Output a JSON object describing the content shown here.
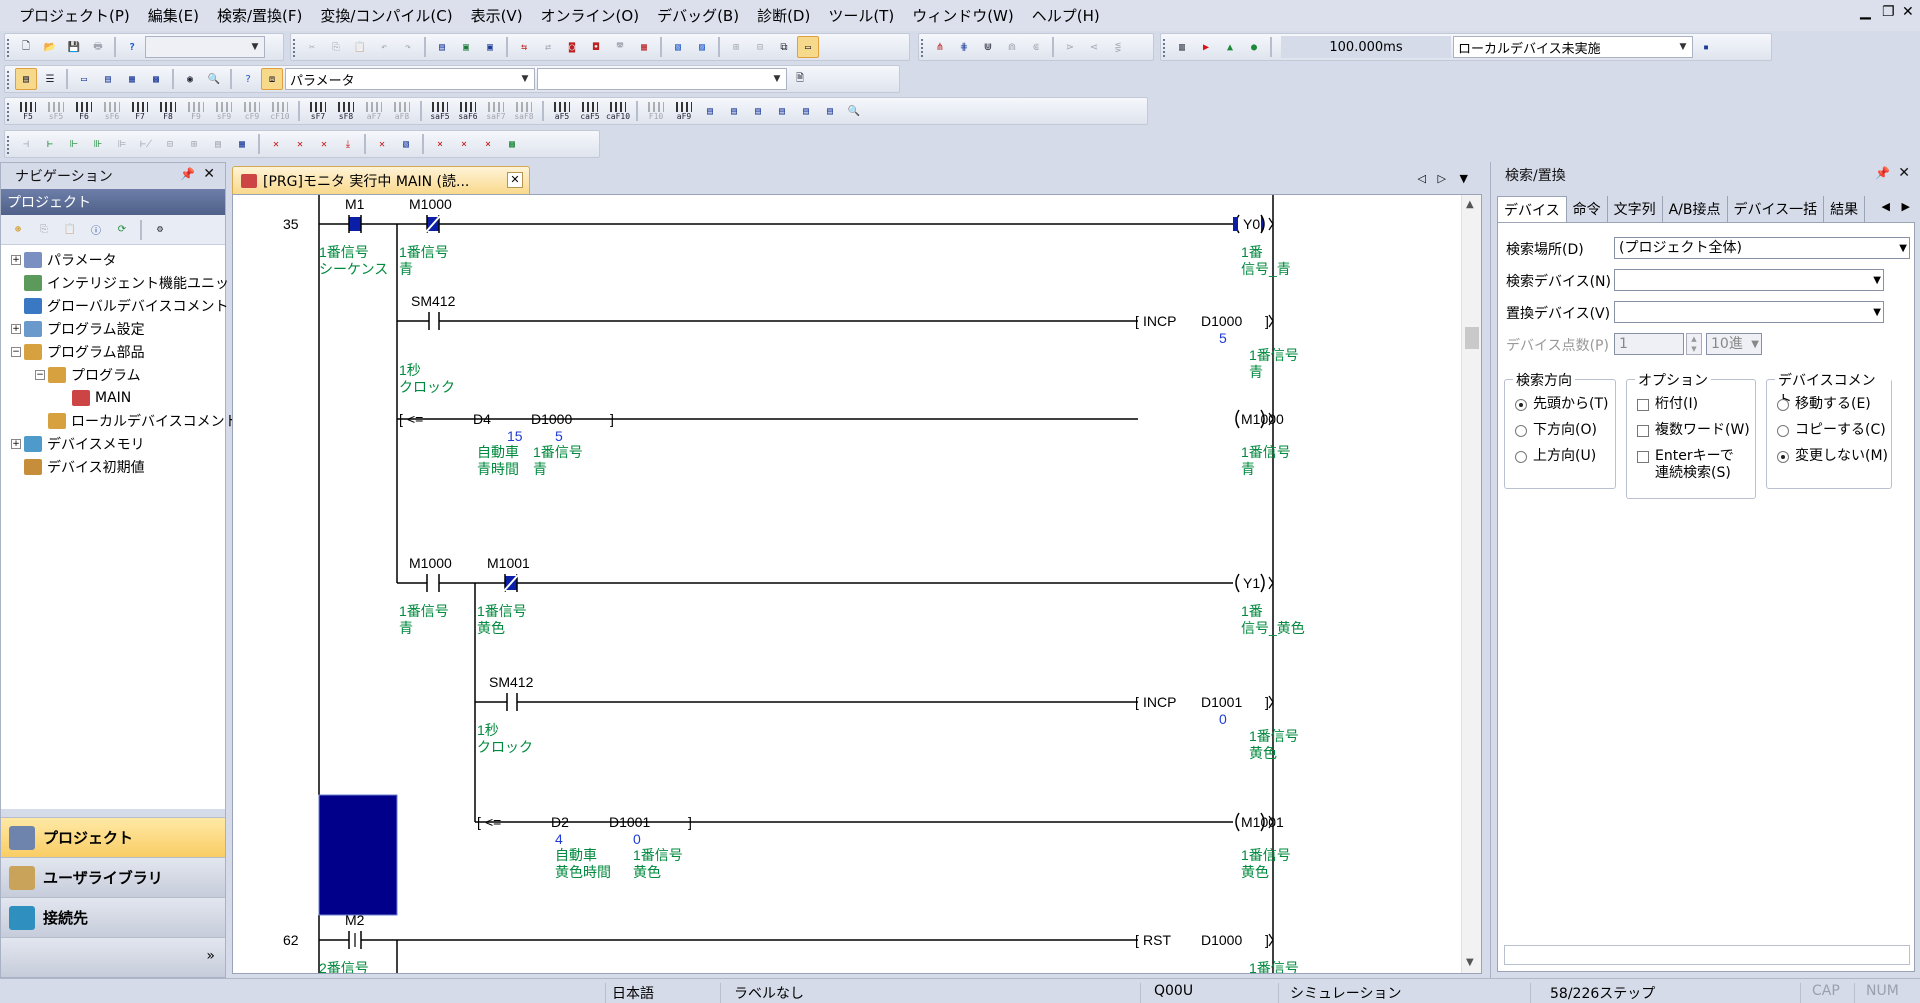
{
  "menu": [
    "プロジェクト(P)",
    "編集(E)",
    "検索/置換(F)",
    "変換/コンパイル(C)",
    "表示(V)",
    "オンライン(O)",
    "デバッグ(B)",
    "診断(D)",
    "ツール(T)",
    "ウィンドウ(W)",
    "ヘルプ(H)"
  ],
  "toolbar": {
    "scan_time": "100.000ms",
    "local_device": "ローカルデバイス未実施",
    "param_combo": "パラメータ"
  },
  "fkeys": [
    "F5",
    "sF5",
    "F6",
    "sF6",
    "F7",
    "F8",
    "F9",
    "sF9",
    "cF9",
    "cF10",
    "sF7",
    "sF8",
    "aF7",
    "aF8",
    "saF5",
    "saF6",
    "saF7",
    "saF8",
    "aF5",
    "caF5",
    "caF10",
    "F10",
    "aF9"
  ],
  "nav": {
    "title": "ナビゲーション",
    "project_header": "プロジェクト",
    "tree": [
      {
        "label": "パラメータ",
        "level": 0,
        "exp": "+"
      },
      {
        "label": "インテリジェント機能ユニット",
        "level": 0,
        "exp": ""
      },
      {
        "label": "グローバルデバイスコメント",
        "level": 0,
        "exp": ""
      },
      {
        "label": "プログラム設定",
        "level": 0,
        "exp": "+"
      },
      {
        "label": "プログラム部品",
        "level": 0,
        "exp": "−"
      },
      {
        "label": "プログラム",
        "level": 1,
        "exp": "−"
      },
      {
        "label": "MAIN",
        "level": 2,
        "exp": ""
      },
      {
        "label": "ローカルデバイスコメント",
        "level": 1,
        "exp": ""
      },
      {
        "label": "デバイスメモリ",
        "level": 0,
        "exp": "+"
      },
      {
        "label": "デバイス初期値",
        "level": 0,
        "exp": ""
      }
    ],
    "bottom": [
      "プロジェクト",
      "ユーザライブラリ",
      "接続先"
    ]
  },
  "editor": {
    "tab_title": "[PRG]モニタ 実行中 MAIN (読...",
    "step_35": "35",
    "step_62": "62",
    "r1_c1_dev": "M1",
    "r1_c1_cmt1": "1番信号",
    "r1_c1_cmt2": "シーケンス",
    "r1_c2_dev": "M1000",
    "r1_c2_cmt1": "1番信号",
    "r1_c2_cmt2": "青",
    "r1_out_dev": "Y0",
    "r1_out_cmt1": "1番",
    "r1_out_cmt2": "信号_青",
    "r2_c_dev": "SM412",
    "r2_c_cmt1": "1秒",
    "r2_c_cmt2": "クロック",
    "r2_inst": "INCP",
    "r2_op": "D1000",
    "r2_val": "5",
    "r2_op_cmt1": "1番信号",
    "r2_op_cmt2": "青",
    "r3_cmp": "<=",
    "r3_op1": "D4",
    "r3_op1_val": "15",
    "r3_op1_cmt1": "自動車",
    "r3_op1_cmt2": "青時間",
    "r3_op2": "D1000",
    "r3_op2_val": "5",
    "r3_op2_cmt1": "1番信号",
    "r3_op2_cmt2": "青",
    "r3_out": "M1000",
    "r3_out_cmt1": "1番信号",
    "r3_out_cmt2": "青",
    "r4_c1_dev": "M1000",
    "r4_c1_cmt1": "1番信号",
    "r4_c1_cmt2": "青",
    "r4_c2_dev": "M1001",
    "r4_c2_cmt1": "1番信号",
    "r4_c2_cmt2": "黄色",
    "r4_out": "Y1",
    "r4_out_cmt1": "1番",
    "r4_out_cmt2": "信号_黄色",
    "r5_c_dev": "SM412",
    "r5_c_cmt1": "1秒",
    "r5_c_cmt2": "クロック",
    "r5_inst": "INCP",
    "r5_op": "D1001",
    "r5_val": "0",
    "r5_op_cmt1": "1番信号",
    "r5_op_cmt2": "黄色",
    "r6_cmp": "<=",
    "r6_op1": "D2",
    "r6_op1_val": "4",
    "r6_op1_cmt1": "自動車",
    "r6_op1_cmt2": "黄色時間",
    "r6_op2": "D1001",
    "r6_op2_val": "0",
    "r6_op2_cmt1": "1番信号",
    "r6_op2_cmt2": "黄色",
    "r6_out": "M1001",
    "r6_out_cmt1": "1番信号",
    "r6_out_cmt2": "黄色",
    "r7_c_dev": "M2",
    "r7_c_cmt1": "2番信号",
    "r7_inst": "RST",
    "r7_op": "D1000",
    "r7_op_cmt1": "1番信号"
  },
  "search": {
    "title": "検索/置換",
    "tabs": [
      "デバイス",
      "命令",
      "文字列",
      "A/B接点",
      "デバイス一括",
      "結果"
    ],
    "location_label": "検索場所(D)",
    "location_value": "(プロジェクト全体)",
    "device_label": "検索デバイス(N)",
    "replace_label": "置換デバイス(V)",
    "count_label": "デバイス点数(P)",
    "count_value": "1",
    "radix_value": "10進",
    "dir_group": "検索方向",
    "dir_opts": [
      "先頭から(T)",
      "下方向(O)",
      "上方向(U)"
    ],
    "opt_group": "オプション",
    "opt_opts": [
      "桁付(I)",
      "複数ワード(W)",
      "Enterキーで",
      "連続検索(S)"
    ],
    "cmt_group": "デバイスコメント",
    "cmt_opts": [
      "移動する(E)",
      "コピーする(C)",
      "変更しない(M)"
    ]
  },
  "status": {
    "lang": "日本語",
    "label": "ラベルなし",
    "cpu": "Q00U",
    "mode": "シミュレーション",
    "steps": "58/226ステップ",
    "cap": "CAP",
    "num": "NUM"
  },
  "colors": {
    "comment": "#008a3e",
    "value": "#1f3bd6",
    "on": "#0a1ea8",
    "selected_block": "#00008b"
  }
}
